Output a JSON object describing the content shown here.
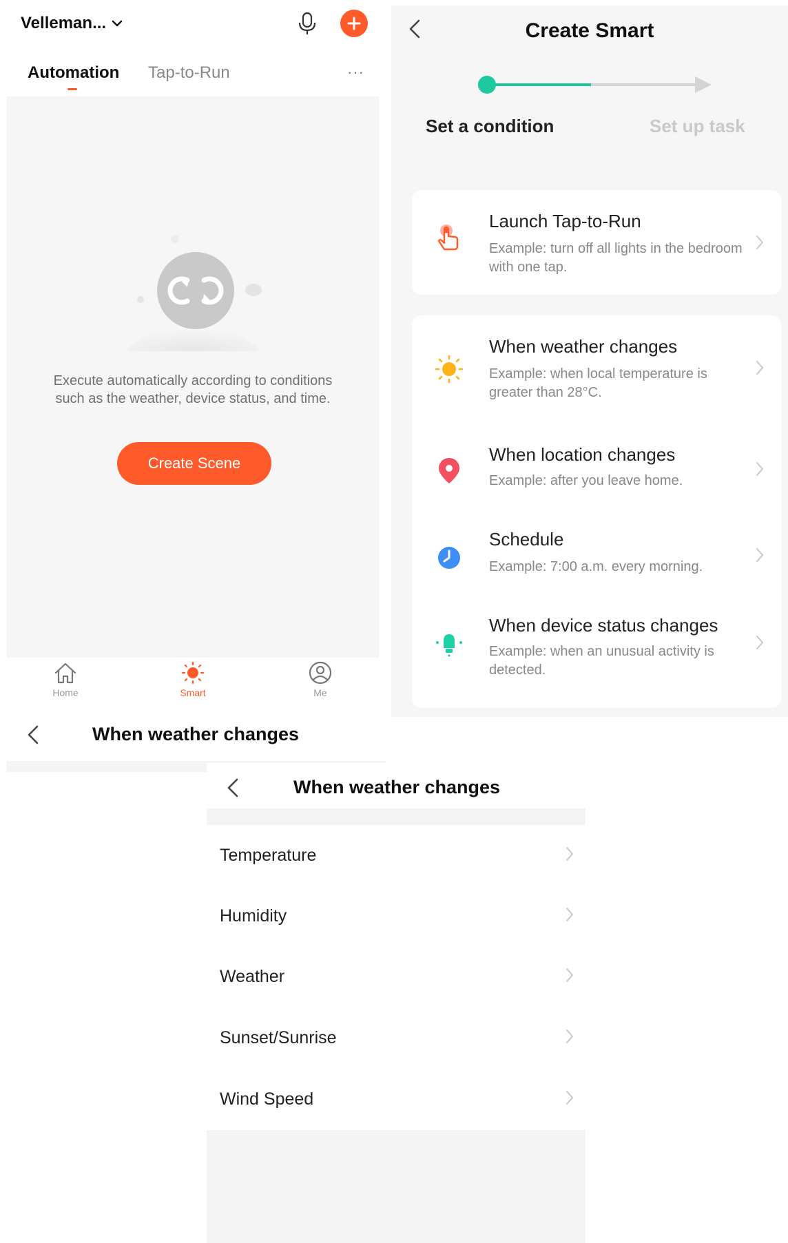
{
  "screen_smart": {
    "home_name": "Velleman...",
    "tabs": {
      "automation": "Automation",
      "tap_to_run": "Tap-to-Run",
      "more": "···"
    },
    "empty_description": "Execute automatically according to conditions such as the weather, device status, and time.",
    "create_button": "Create Scene",
    "bottom_nav": [
      {
        "label": "Home",
        "icon": "home-icon"
      },
      {
        "label": "Smart",
        "icon": "sun-icon"
      },
      {
        "label": "Me",
        "icon": "user-icon"
      }
    ],
    "accent": "#ff5a2a"
  },
  "screen_create": {
    "title": "Create Smart",
    "steps": {
      "step1": "Set a condition",
      "step2": "Set up task"
    },
    "progress_color": "#1ec9a0",
    "launch": {
      "title": "Launch Tap-to-Run",
      "subtitle": "Example: turn off all lights in the bedroom with one tap."
    },
    "conditions": [
      {
        "title": "When weather changes",
        "subtitle": "Example: when local temperature is greater than 28°C.",
        "icon": "sun-icon",
        "color": "#ffb21a"
      },
      {
        "title": "When location changes",
        "subtitle": "Example: after you leave home.",
        "icon": "location-pin-icon",
        "color": "#f25060"
      },
      {
        "title": "Schedule",
        "subtitle": "Example: 7:00 a.m. every morning.",
        "icon": "clock-icon",
        "color": "#3f8ef5"
      },
      {
        "title": "When device status changes",
        "subtitle": "Example: when an unusual activity is detected.",
        "icon": "device-icon",
        "color": "#1fd0a5"
      }
    ]
  },
  "screen_weather_partial": {
    "title": "When weather changes"
  },
  "screen_weather": {
    "title": "When weather changes",
    "items": [
      "Temperature",
      "Humidity",
      "Weather",
      "Sunset/Sunrise",
      "Wind Speed"
    ]
  }
}
